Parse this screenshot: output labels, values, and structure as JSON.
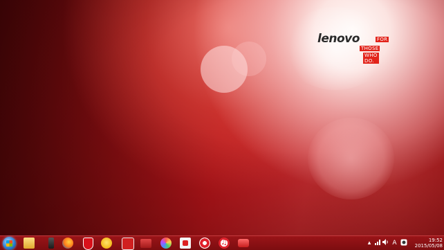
{
  "desktop": {
    "logo": {
      "wordmark": "lenovo",
      "tag_lines": [
        "FOR",
        "THOSE",
        "WHO DO."
      ]
    }
  },
  "taskbar": {
    "pinned_icons": [
      "start-orb-icon",
      "file-explorer-icon",
      "dark-app-icon",
      "firefox-icon",
      "security-shield-icon",
      "emoji-app-icon",
      "tool-app-icon",
      "red-app-icon",
      "paint-palette-icon",
      "white-red-app-icon",
      "lifebuoy-icon",
      "music-player-icon",
      "photo-app-icon"
    ],
    "tray": {
      "icons": [
        "show-hidden-icons-arrow",
        "network-signal-icon",
        "volume-icon",
        "ime-icon",
        "shield-tray-icon"
      ],
      "ime_label": "A",
      "clock": {
        "time": "19:52",
        "date": "2015/05/08"
      }
    }
  },
  "colors": {
    "taskbar": "#8a1013",
    "accent_red": "#e2231a"
  }
}
